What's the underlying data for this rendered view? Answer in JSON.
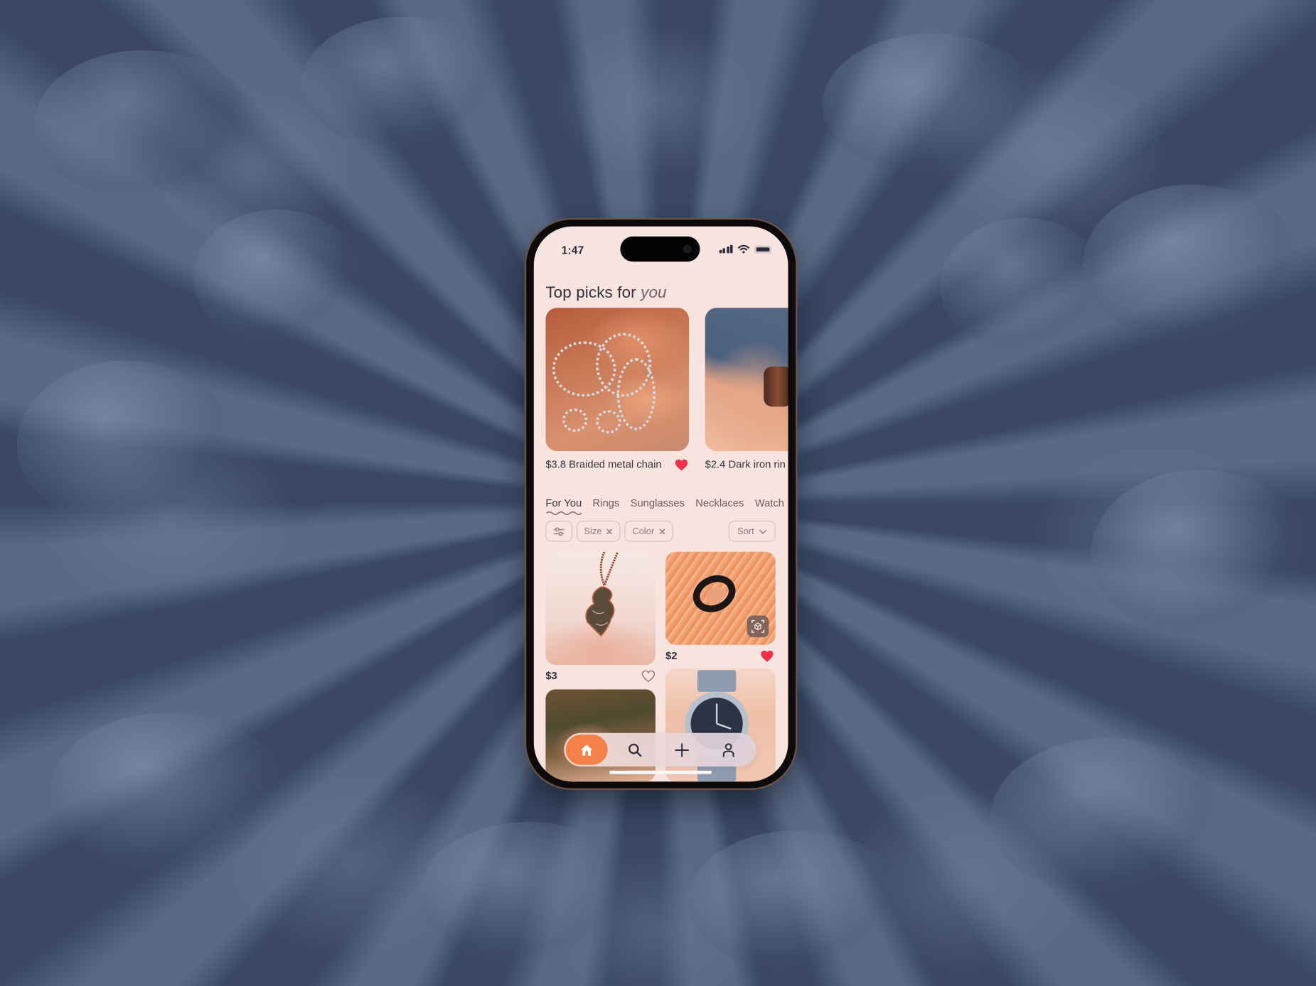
{
  "status_bar": {
    "time": "1:47"
  },
  "header": {
    "title_plain": "Top picks for ",
    "title_emphasis": "you"
  },
  "top_picks": [
    {
      "price": "$3.8",
      "name": "Braided metal chain",
      "liked": true
    },
    {
      "price": "$2.4",
      "name": "Dark iron ring",
      "liked": false
    }
  ],
  "top_pick_labels": [
    "$3.8 Braided metal chain",
    "$2.4 Dark iron rin"
  ],
  "categories": {
    "tabs": [
      {
        "label": "For You",
        "active": true
      },
      {
        "label": "Rings",
        "active": false
      },
      {
        "label": "Sunglasses",
        "active": false
      },
      {
        "label": "Necklaces",
        "active": false
      },
      {
        "label": "Watch",
        "active": false
      }
    ]
  },
  "filters": {
    "chips": [
      {
        "label": "Size",
        "removable": true
      },
      {
        "label": "Color",
        "removable": true
      }
    ],
    "sort_label": "Sort"
  },
  "products": [
    {
      "price": "$3",
      "liked": false
    },
    {
      "price": "$2",
      "liked": true,
      "ar_view": true
    },
    {
      "price": "",
      "liked": false
    },
    {
      "price": "",
      "liked": false
    }
  ],
  "nav": {
    "items": [
      {
        "icon": "home-icon",
        "active": true
      },
      {
        "icon": "search-icon",
        "active": false
      },
      {
        "icon": "plus-icon",
        "active": false
      },
      {
        "icon": "profile-icon",
        "active": false
      }
    ]
  },
  "colors": {
    "accent": "#f48148",
    "like": "#f2304a",
    "screen_bg": "#f7e4de",
    "text": "#333340"
  }
}
